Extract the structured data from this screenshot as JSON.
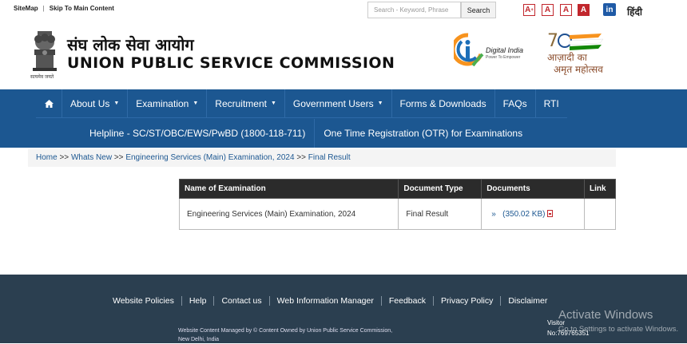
{
  "topbar": {
    "sitemap": "SiteMap",
    "separator": "|",
    "skip": "Skip To Main Content",
    "search_placeholder": "Search - Keyword, Phrase",
    "search_button": "Search",
    "font_small": "A",
    "font_small_sup": "+",
    "font_normal": "A",
    "font_large": "A",
    "font_dark": "A",
    "linkedin": "in",
    "language": "हिंदी"
  },
  "header": {
    "title_hindi": "संघ लोक सेवा आयोग",
    "title_english": "UNION PUBLIC SERVICE COMMISSION",
    "emblem_caption": "सत्यमेव जयते",
    "digital_india": "Digital India",
    "digital_india_tagline": "Power To Empower",
    "azadi_text1": "आज़ादी का",
    "azadi_text2": "अमृत महोत्सव"
  },
  "nav": {
    "row1": [
      {
        "label": "About Us",
        "caret": true
      },
      {
        "label": "Examination",
        "caret": true
      },
      {
        "label": "Recruitment",
        "caret": true
      },
      {
        "label": "Government Users",
        "caret": true
      },
      {
        "label": "Forms & Downloads",
        "caret": false
      },
      {
        "label": "FAQs",
        "caret": false
      },
      {
        "label": "RTI",
        "caret": false
      }
    ],
    "row2": [
      {
        "label": "Helpline - SC/ST/OBC/EWS/PwBD (1800-118-711)"
      },
      {
        "label": "One Time Registration (OTR) for Examinations"
      }
    ]
  },
  "breadcrumb": {
    "home": "Home",
    "sep": ">>",
    "whats_new": "Whats New",
    "exam": "Engineering Services (Main) Examination, 2024",
    "current": "Final Result"
  },
  "table": {
    "headers": [
      "Name of Examination",
      "Document Type",
      "Documents",
      "Link"
    ],
    "rows": [
      {
        "name": "Engineering Services (Main) Examination, 2024",
        "type": "Final Result",
        "doc_marker": "»",
        "doc": "(350.02 KB)",
        "link": ""
      }
    ]
  },
  "footer": {
    "links": [
      "Website Policies",
      "Help",
      "Contact us",
      "Web Information Manager",
      "Feedback",
      "Privacy Policy",
      "Disclaimer"
    ],
    "note": "Website Content Managed by © Content Owned by Union Public Service Commission, New Delhi, India",
    "visitor_label": "Visitor",
    "visitor_no": "No:769765351",
    "win_title": "Activate Windows",
    "win_sub": "Go to Settings to activate Windows."
  }
}
